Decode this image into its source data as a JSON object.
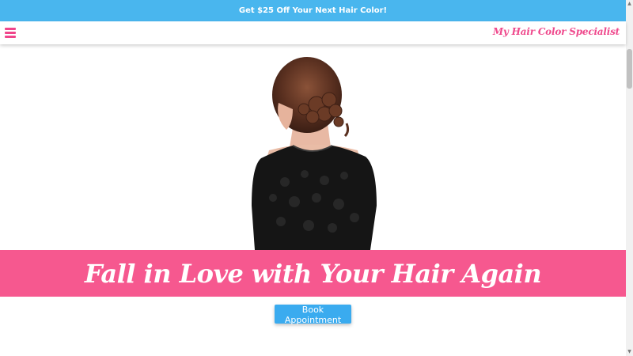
{
  "promo": {
    "text": "Get $25 Off Your Next Hair Color!"
  },
  "header": {
    "menu_icon": "hamburger-menu-icon",
    "brand": "My Hair Color Specialist"
  },
  "hero": {
    "title": "Fall in Love with Your Hair Again",
    "cta_label": "Book Appointment"
  },
  "colors": {
    "promo_bg": "#49b6ee",
    "accent_pink": "#f6588f",
    "brand_pink": "#ef4a8d",
    "button_blue": "#3aabef"
  }
}
